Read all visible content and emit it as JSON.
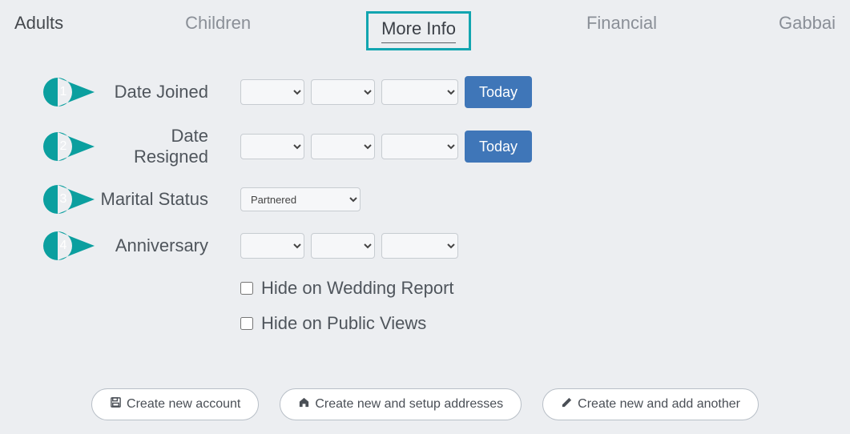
{
  "tabs": {
    "adults": "Adults",
    "children": "Children",
    "more_info": "More Info",
    "financial": "Financial",
    "gabbai": "Gabbai"
  },
  "callouts": {
    "n1": "1",
    "n2": "2",
    "n3": "3",
    "n4": "4"
  },
  "labels": {
    "date_joined": "Date Joined",
    "date_resigned": "Date Resigned",
    "marital_status": "Marital Status",
    "anniversary": "Anniversary"
  },
  "buttons": {
    "today": "Today",
    "create_account": "Create new account",
    "create_addresses": "Create new and setup addresses",
    "create_another": "Create new and add another"
  },
  "marital_options": {
    "selected": "Partnered"
  },
  "checkboxes": {
    "hide_wedding": "Hide on Wedding Report",
    "hide_public": "Hide on Public Views"
  },
  "colors": {
    "teal": "#12a5b0",
    "callout": "#0b9f9f",
    "primary_btn": "#3f76b8"
  }
}
